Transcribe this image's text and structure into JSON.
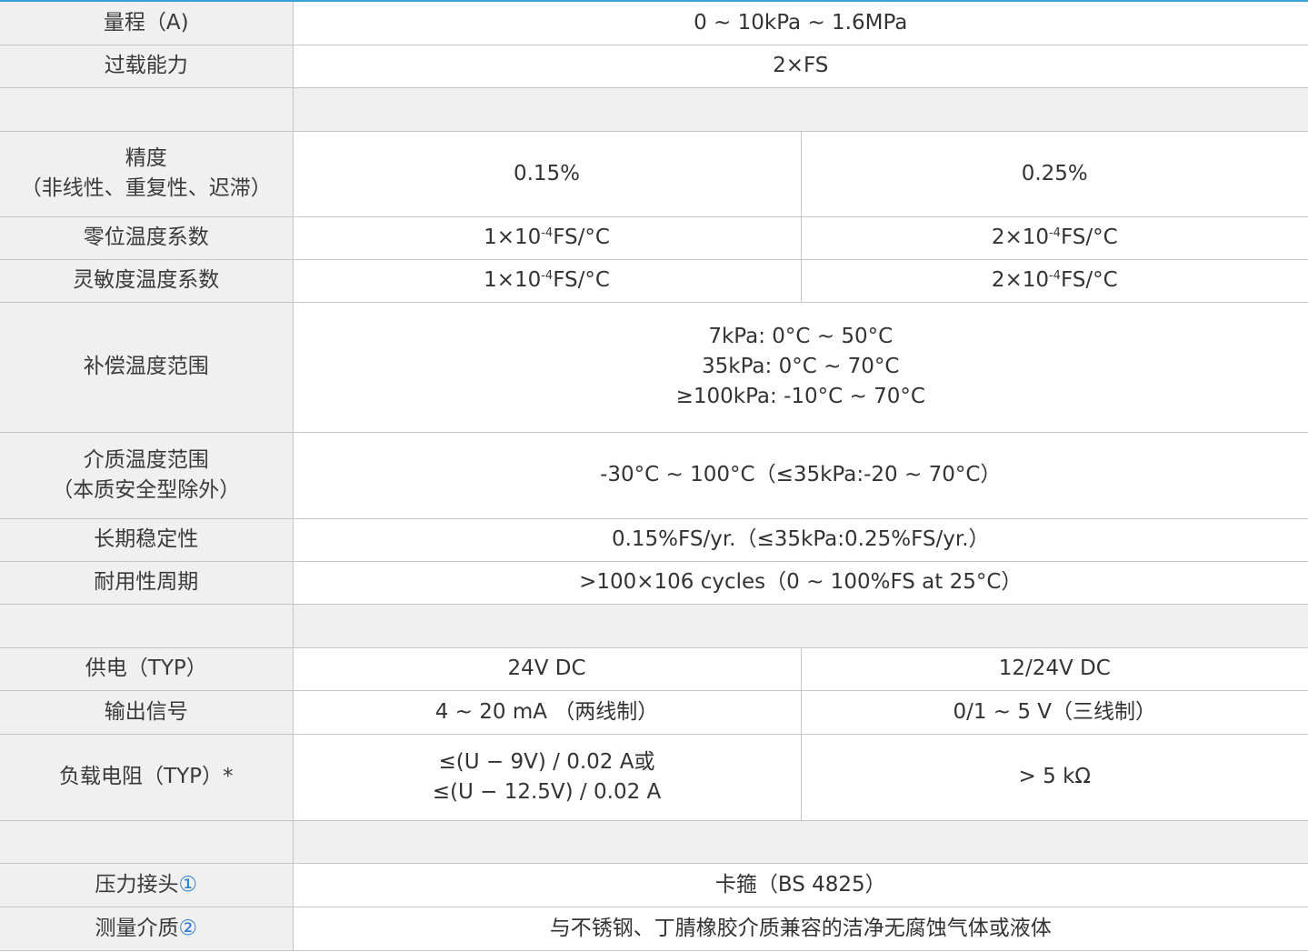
{
  "rows": [
    {
      "label": "量程（A)",
      "value": "0 ~ 10kPa ~ 1.6MPa"
    },
    {
      "label": "过载能力",
      "value": "2×FS"
    },
    {
      "accuracy_label_1": "精度",
      "accuracy_label_2": "（非线性、重复性、迟滞）",
      "left": "0.15%",
      "right": "0.25%"
    },
    {
      "label": "零位温度系数",
      "left_pre": "1×10",
      "left_sup": "-4",
      "left_post": "FS/°C",
      "right_pre": "2×10",
      "right_sup": "-4",
      "right_post": "FS/°C"
    },
    {
      "label": "灵敏度温度系数",
      "left_pre": "1×10",
      "left_sup": "-4",
      "left_post": "FS/°C",
      "right_pre": "2×10",
      "right_sup": "-4",
      "right_post": "FS/°C"
    },
    {
      "label": "补偿温度范围",
      "line1": "7kPa: 0°C ~ 50°C",
      "line2": "35kPa: 0°C ~ 70°C",
      "line3": "≥100kPa: -10°C ~ 70°C"
    },
    {
      "label_1": "介质温度范围",
      "label_2": "（本质安全型除外）",
      "value": "-30°C ~ 100°C（≤35kPa:-20 ~ 70°C）"
    },
    {
      "label": "长期稳定性",
      "value": "0.15%FS/yr.（≤35kPa:0.25%FS/yr.）"
    },
    {
      "label": "耐用性周期",
      "value": ">100×106 cycles（0 ~ 100%FS at 25°C）"
    },
    {
      "label": "供电（TYP）",
      "left": "24V DC",
      "right": "12/24V DC"
    },
    {
      "label": "输出信号",
      "left": "4 ~ 20 mA （两线制）",
      "right": "0/1 ~ 5 V（三线制）"
    },
    {
      "label": "负载电阻（TYP）*",
      "left_1": "≤(U − 9V) / 0.02 A或",
      "left_2": "≤(U − 12.5V) / 0.02 A",
      "right": "> 5 kΩ"
    },
    {
      "label": "压力接头",
      "mark": "①",
      "value": "卡箍（BS 4825）"
    },
    {
      "label": "测量介质",
      "mark": "②",
      "value": "与不锈钢、丁腈橡胶介质兼容的洁净无腐蚀气体或液体"
    }
  ],
  "accent_color": "#3aa0dc",
  "label_bg": "#f0f0f0",
  "border_color": "#c6c6c6"
}
